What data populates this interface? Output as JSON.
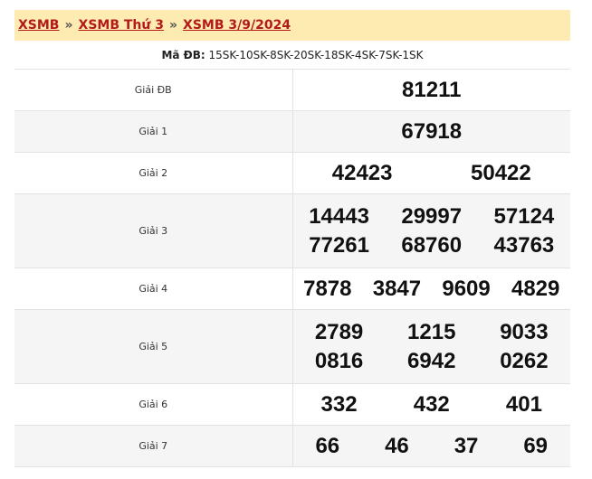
{
  "breadcrumb": {
    "items": [
      "XSMB",
      "XSMB Thứ 3",
      "XSMB 3/9/2024"
    ],
    "separator": "»"
  },
  "code": {
    "label": "Mã ĐB:",
    "value": "15SK-10SK-8SK-20SK-18SK-4SK-7SK-1SK"
  },
  "prizes": {
    "db": {
      "label": "Giải ĐB",
      "numbers": [
        "81211"
      ]
    },
    "g1": {
      "label": "Giải 1",
      "numbers": [
        "67918"
      ]
    },
    "g2": {
      "label": "Giải 2",
      "numbers": [
        "42423",
        "50422"
      ]
    },
    "g3": {
      "label": "Giải 3",
      "numbers": [
        "14443",
        "29997",
        "57124",
        "77261",
        "68760",
        "43763"
      ]
    },
    "g4": {
      "label": "Giải 4",
      "numbers": [
        "7878",
        "3847",
        "9609",
        "4829"
      ]
    },
    "g5": {
      "label": "Giải 5",
      "numbers": [
        "2789",
        "1215",
        "9033",
        "0816",
        "6942",
        "0262"
      ]
    },
    "g6": {
      "label": "Giải 6",
      "numbers": [
        "332",
        "432",
        "401"
      ]
    },
    "g7": {
      "label": "Giải 7",
      "numbers": [
        "66",
        "46",
        "37",
        "69"
      ]
    }
  },
  "colors": {
    "accent_red": "#b31b1b",
    "breadcrumb_bg": "#fdebb1",
    "alt_row_bg": "#f5f5f5"
  }
}
